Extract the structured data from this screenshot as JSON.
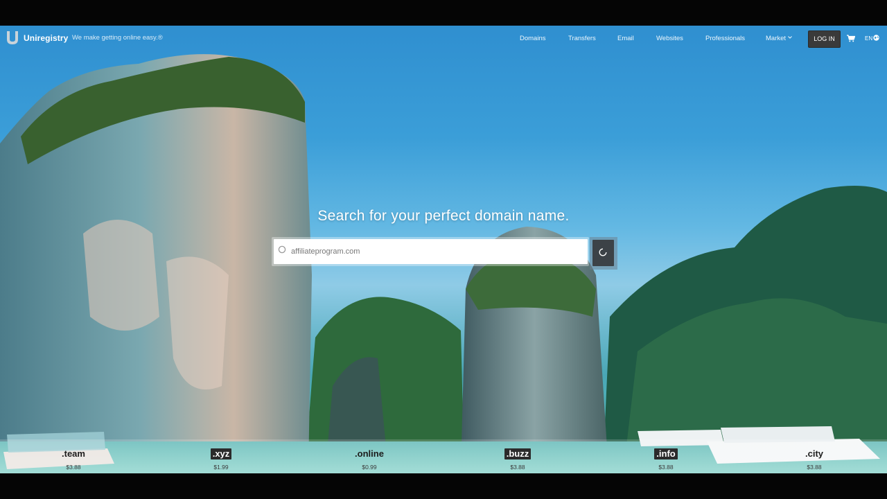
{
  "brand": {
    "name": "Uniregistry",
    "tagline": "We make getting online easy.®"
  },
  "nav": {
    "links": [
      "Domains",
      "Transfers",
      "Email",
      "Websites",
      "Professionals",
      "Market"
    ],
    "login_label": "LOG IN",
    "language": "EN"
  },
  "hero": {
    "title": "Search for your perfect domain name."
  },
  "search": {
    "value": "affiliateprogram.com"
  },
  "tlds": [
    {
      "name": ".team",
      "price": "$3.88"
    },
    {
      "name": ".xyz",
      "price": "$1.99"
    },
    {
      "name": ".online",
      "price": "$0.99"
    },
    {
      "name": ".buzz",
      "price": "$3.88"
    },
    {
      "name": ".info",
      "price": "$3.88"
    },
    {
      "name": ".city",
      "price": "$3.88"
    }
  ],
  "colors": {
    "login_bg": "#3a3a3a",
    "search_button_bg": "#3c4247"
  }
}
